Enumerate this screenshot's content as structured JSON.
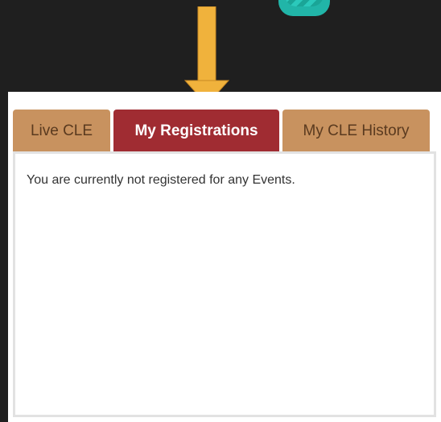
{
  "tabs": [
    {
      "label": "Live CLE",
      "active": false
    },
    {
      "label": "My Registrations",
      "active": true
    },
    {
      "label": "My CLE History",
      "active": false
    }
  ],
  "content": {
    "message": "You are currently not registered for any Events."
  },
  "colors": {
    "background": "#1f1f1f",
    "tab_inactive": "#c8925f",
    "tab_active": "#a02c32",
    "arrow": "#f0b23c",
    "accent_shape": "#21b5a8"
  },
  "icons": {
    "arrow": "down-arrow-icon",
    "decoration": "teal-shape"
  }
}
